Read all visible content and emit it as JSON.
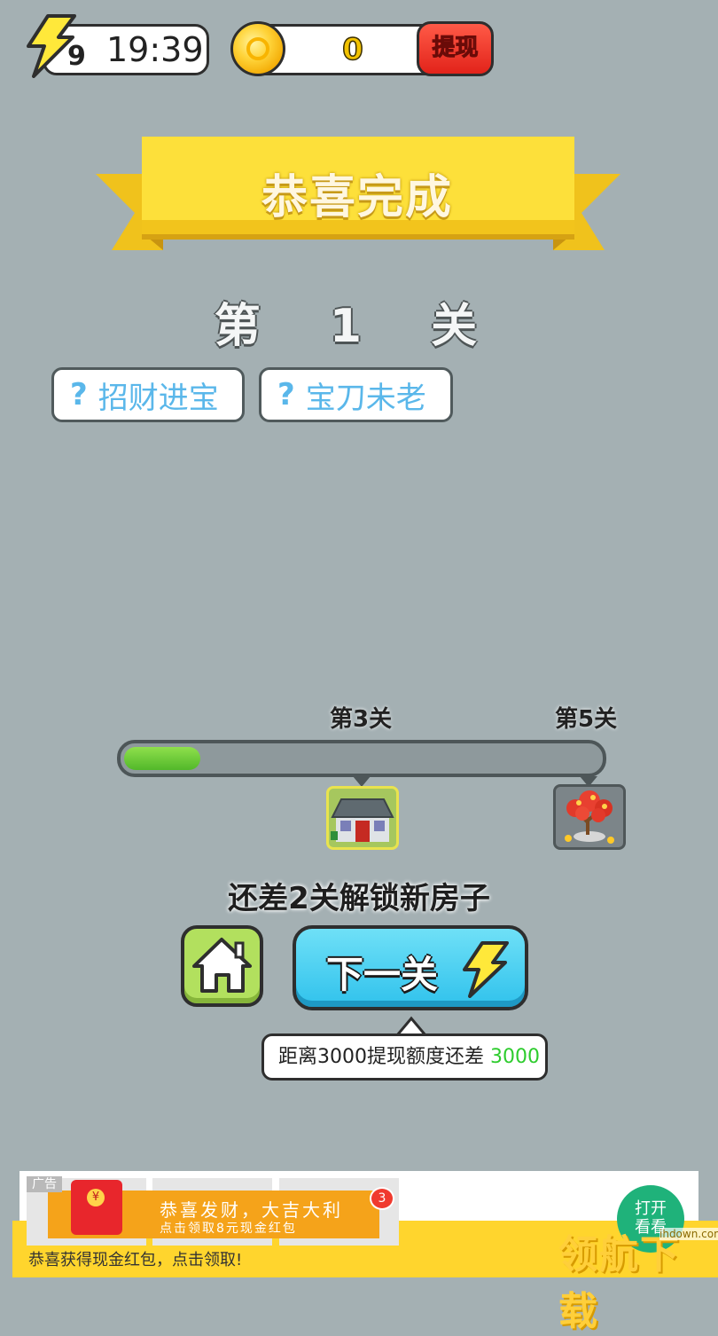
{
  "header": {
    "energy_count": "9",
    "timer": "19:39",
    "coins": "0",
    "withdraw_label": "提现"
  },
  "banner": {
    "title": "恭喜完成"
  },
  "level": {
    "label": "第 1 关"
  },
  "hints": [
    {
      "icon": "?",
      "label": "招财进宝"
    },
    {
      "icon": "?",
      "label": "宝刀未老"
    }
  ],
  "progress": {
    "milestones": [
      {
        "label": "第3关",
        "reward": "house-icon"
      },
      {
        "label": "第5关",
        "reward": "money-tree-icon"
      }
    ],
    "fraction": 0.16
  },
  "unlock_text": "还差2关解锁新房子",
  "buttons": {
    "next_label": "下一关"
  },
  "tip": {
    "prefix": "距离3000提现额度还差 ",
    "amount": "3000",
    "amount_color": "#2ecc2e"
  },
  "ad": {
    "tag": "广告",
    "headline": "恭喜发财，大吉大利",
    "sub": "点击领取8元现金红包",
    "badge": "3",
    "bottom_text": "恭喜获得现金红包，点击领取!",
    "open_label": "打开看看"
  },
  "watermark": {
    "logo": "领航下载",
    "site": "ihdown.com"
  }
}
